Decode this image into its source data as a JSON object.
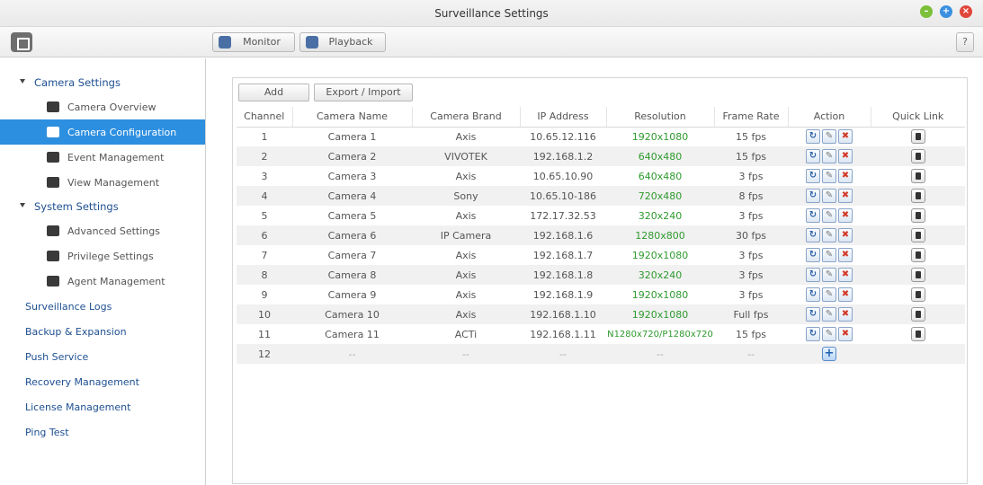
{
  "window": {
    "title": "Surveillance Settings"
  },
  "toolbar": {
    "monitor_label": "Monitor",
    "playback_label": "Playback",
    "help_label": "?"
  },
  "sidebar": {
    "camera_settings": "Camera Settings",
    "camera_items": [
      "Camera Overview",
      "Camera Configuration",
      "Event Management",
      "View Management"
    ],
    "system_settings": "System Settings",
    "system_items": [
      "Advanced Settings",
      "Privilege Settings",
      "Agent Management"
    ],
    "top_items": [
      "Surveillance Logs",
      "Backup & Expansion",
      "Push Service",
      "Recovery Management",
      "License Management",
      "Ping Test"
    ]
  },
  "main": {
    "add_label": "Add",
    "export_label": "Export / Import",
    "headers": [
      "Channel",
      "Camera Name",
      "Camera Brand",
      "IP Address",
      "Resolution",
      "Frame Rate",
      "Action",
      "Quick Link"
    ],
    "rows": [
      {
        "channel": "1",
        "name": "Camera 1",
        "brand": "Axis",
        "ip": "10.65.12.116",
        "resolution": "1920x1080",
        "fps": "15 fps"
      },
      {
        "channel": "2",
        "name": "Camera 2",
        "brand": "VIVOTEK",
        "ip": "192.168.1.2",
        "resolution": "640x480",
        "fps": "15 fps"
      },
      {
        "channel": "3",
        "name": "Camera 3",
        "brand": "Axis",
        "ip": "10.65.10.90",
        "resolution": "640x480",
        "fps": "3 fps"
      },
      {
        "channel": "4",
        "name": "Camera 4",
        "brand": "Sony",
        "ip": "10.65.10-186",
        "resolution": "720x480",
        "fps": "8 fps"
      },
      {
        "channel": "5",
        "name": "Camera 5",
        "brand": "Axis",
        "ip": "172.17.32.53",
        "resolution": "320x240",
        "fps": "3 fps"
      },
      {
        "channel": "6",
        "name": "Camera 6",
        "brand": "IP Camera",
        "ip": "192.168.1.6",
        "resolution": "1280x800",
        "fps": "30 fps"
      },
      {
        "channel": "7",
        "name": "Camera 7",
        "brand": "Axis",
        "ip": "192.168.1.7",
        "resolution": "1920x1080",
        "fps": "3 fps"
      },
      {
        "channel": "8",
        "name": "Camera 8",
        "brand": "Axis",
        "ip": "192.168.1.8",
        "resolution": "320x240",
        "fps": "3 fps"
      },
      {
        "channel": "9",
        "name": "Camera 9",
        "brand": "Axis",
        "ip": "192.168.1.9",
        "resolution": "1920x1080",
        "fps": "3 fps"
      },
      {
        "channel": "10",
        "name": "Camera 10",
        "brand": "Axis",
        "ip": "192.168.1.10",
        "resolution": "1920x1080",
        "fps": "Full fps"
      },
      {
        "channel": "11",
        "name": "Camera 11",
        "brand": "ACTi",
        "ip": "192.168.1.11",
        "resolution": "N1280x720/P1280x720",
        "fps": "15 fps"
      }
    ],
    "empty_row": {
      "channel": "12",
      "placeholder": "--"
    }
  },
  "colors": {
    "accent": "#2d8fe0",
    "resolution_text": "#2e9a2e",
    "delete_icon": "#d23a2a"
  }
}
